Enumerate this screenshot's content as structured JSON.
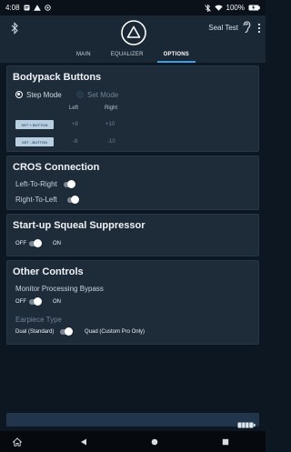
{
  "status_bar": {
    "time": "4:08",
    "battery": "100%"
  },
  "header": {
    "device_name": "Seal Test",
    "tabs": [
      {
        "label": "MAIN",
        "active": false
      },
      {
        "label": "EQUALIZER",
        "active": false
      },
      {
        "label": "OPTIONS",
        "active": true
      }
    ]
  },
  "bodypack": {
    "title": "Bodypack Buttons",
    "mode_step": "Step Mode",
    "mode_set": "Set Mode",
    "selected_mode": "Step Mode",
    "col_left": "Left",
    "col_right": "Right",
    "set_plus_label": "SET + BUTTON",
    "set_minus_label": "SET - BUTTON",
    "plus_left": "+8",
    "plus_right": "+10",
    "minus_left": "-8",
    "minus_right": "-10"
  },
  "cros": {
    "title": "CROS Connection",
    "left_to_right": "Left-To-Right",
    "right_to_left": "Right-To-Left",
    "left_to_right_on": false,
    "right_to_left_on": false
  },
  "squeal": {
    "title": "Start-up Squeal Suppressor",
    "off_label": "OFF",
    "on_label": "ON",
    "enabled": false
  },
  "other": {
    "title": "Other Controls",
    "monitor_label": "Monitor Processing Bypass",
    "off_label": "OFF",
    "on_label": "ON",
    "monitor_enabled": false,
    "earpiece_label": "Earpiece Type",
    "earpiece_dual": "Dual (Standard)",
    "earpiece_quad": "Quad (Custom Pro Only)",
    "earpiece_selected": "Dual (Standard)"
  },
  "colors": {
    "accent": "#3aa0e6",
    "card": "#1e2c3a",
    "background": "#0d1722"
  }
}
